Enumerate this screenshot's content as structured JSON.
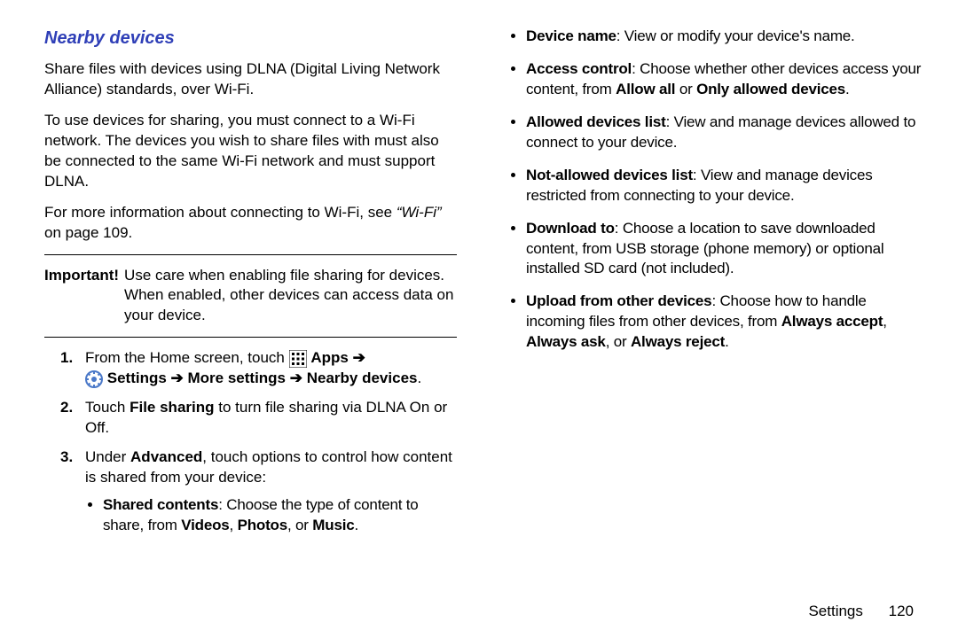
{
  "heading": "Nearby devices",
  "intro1": "Share files with devices using DLNA (Digital Living Network Alliance) standards, over Wi-Fi.",
  "intro2": "To use devices for sharing, you must connect to a Wi-Fi network. The devices you wish to share files with must also be connected to the same Wi-Fi network and must support DLNA.",
  "intro3a": "For more information about connecting to Wi-Fi, see ",
  "intro3_ref": "“Wi-Fi”",
  "intro3b": " on page 109.",
  "important_label": "Important!",
  "important_text": "Use care when enabling file sharing for devices. When enabled, other devices can access data on your device.",
  "step1_a": "From the Home screen, touch ",
  "apps_bold": "Apps",
  "arrow": " ➔ ",
  "settings_bold": "Settings",
  "more_settings_bold": "More settings",
  "nearby_bold": "Nearby devices",
  "period": ".",
  "step2_a": "Touch ",
  "file_sharing_bold": "File sharing",
  "step2_b": " to turn file sharing via DLNA On or Off.",
  "step3_a": "Under ",
  "advanced_bold": "Advanced",
  "step3_b": ", touch options to control how content is shared from your device:",
  "shared_contents_bold": "Shared contents",
  "shared_contents_text": ": Choose the type of content to share, from ",
  "videos_bold": "Videos",
  "photos_bold": "Photos",
  "music_bold": "Music",
  "comma_sp": ", ",
  "or_sp": ", or ",
  "device_name_bold": "Device name",
  "device_name_text": ": View or modify your device's name.",
  "access_control_bold": "Access control",
  "access_control_text_a": ": Choose whether other devices access your content, from ",
  "allow_all_bold": "Allow all",
  "or_word": " or ",
  "only_allowed_bold": "Only allowed devices",
  "allowed_list_bold": "Allowed devices list",
  "allowed_list_text": ": View and manage devices allowed to connect to your device.",
  "not_allowed_bold": "Not-allowed devices list",
  "not_allowed_text": ": View and manage devices restricted from connecting to your device.",
  "download_to_bold": "Download to",
  "download_to_text": ": Choose a location to save downloaded content, from USB storage (phone memory) or optional installed SD card (not included).",
  "upload_bold": "Upload from other devices",
  "upload_text_a": ": Choose how to handle incoming files from other devices, from ",
  "always_accept_bold": "Always accept",
  "always_ask_bold": "Always ask",
  "always_reject_bold": "Always reject",
  "footer_section": "Settings",
  "footer_page": "120"
}
